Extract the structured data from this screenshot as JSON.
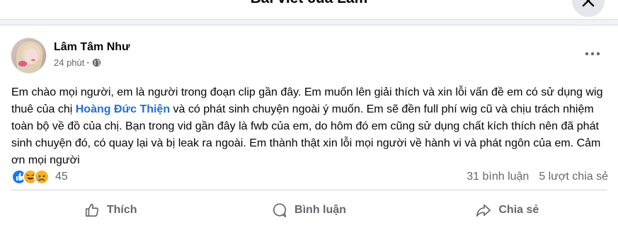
{
  "dialog": {
    "title": "Bài viết của Lâm"
  },
  "post": {
    "author": "Lâm Tâm Như",
    "time": "24 phút",
    "privacy_icon": "globe-icon",
    "text_part1": "Em chào mọi người, em là người trong đoạn clip gần đây. Em muốn lên giải thích và xin lỗi vấn đề em có sử dụng wig thuê của chị ",
    "mention": "Hoàng Đức Thiện",
    "text_part2": " và có phát sinh chuyện ngoài ý muốn. Em sẽ đền full phí wig cũ và chịu trách nhiệm toàn bộ về đồ của chị. Bạn trong vid gần đây là fwb của em, do hôm đó em cũng sử dụng chất kích thích nên đã phát sinh chuyện đó, có quay lại và bị leak ra ngoài. Em thành thật xin lỗi mọi người về hành vi và phát ngôn của em. Cảm ơn mọi người"
  },
  "reactions": {
    "icons": [
      "like-icon",
      "haha-icon",
      "sad-icon"
    ],
    "count": "45"
  },
  "stats": {
    "comments": "31 bình luận",
    "shares": "5 lượt chia sẻ"
  },
  "actions": {
    "like": "Thích",
    "comment": "Bình luận",
    "share": "Chia sẻ"
  },
  "colors": {
    "accent": "#216fdb",
    "like_blue": "#1877f2",
    "reaction_yellow": "#f7b125",
    "secondary_text": "#65676b"
  }
}
